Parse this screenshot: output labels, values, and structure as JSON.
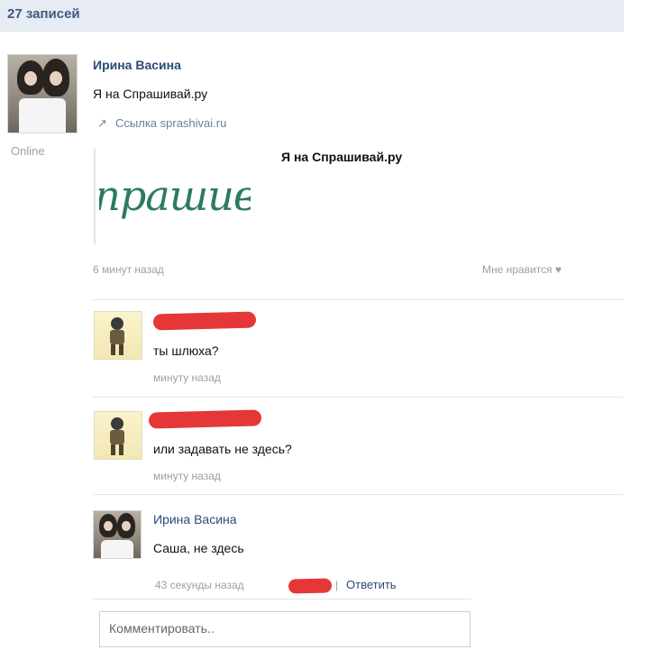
{
  "wall": {
    "count_label": "27 записей"
  },
  "post": {
    "author": "Ирина Васина",
    "status": "Online",
    "text": "Я на Спрашивай.ру",
    "link_label": "Ссылка sprashivai.ru",
    "attachment_title": "Я на Спрашивай.ру",
    "attachment_brand": "Спрашивай.ру",
    "time": "6 минут назад",
    "like_label": "Мне нравится ♥"
  },
  "comments": [
    {
      "text": "ты шлюха?",
      "time": "минуту назад"
    },
    {
      "text": "или задавать не здесь?",
      "time": "минуту назад"
    },
    {
      "author": "Ирина Васина",
      "text": "Саша, не здесь",
      "time": "43 секунды назад",
      "reply_label": "Ответить"
    }
  ],
  "comment_box": {
    "placeholder": "Комментировать.."
  },
  "colors": {
    "accent": "#2b4a78",
    "redaction": "#e32626",
    "topbar_bg": "#e6ebf4"
  }
}
